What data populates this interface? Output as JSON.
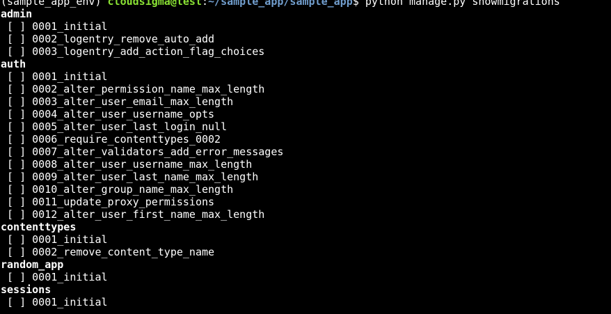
{
  "prompt": {
    "env": "(sample_app_env) ",
    "userhost": "cloudsigma@test",
    "colon": ":",
    "path": "~/sample_app/sample_app",
    "symbol": "$ ",
    "command": "python manage.py showmigrations"
  },
  "colors": {
    "userhost": "#8ae234",
    "path": "#729fcf",
    "background": "#000000",
    "text": "#ffffff"
  },
  "apps": [
    {
      "name": "admin",
      "migrations": [
        {
          "check": " [ ] ",
          "name": "0001_initial"
        },
        {
          "check": " [ ] ",
          "name": "0002_logentry_remove_auto_add"
        },
        {
          "check": " [ ] ",
          "name": "0003_logentry_add_action_flag_choices"
        }
      ]
    },
    {
      "name": "auth",
      "migrations": [
        {
          "check": " [ ] ",
          "name": "0001_initial"
        },
        {
          "check": " [ ] ",
          "name": "0002_alter_permission_name_max_length"
        },
        {
          "check": " [ ] ",
          "name": "0003_alter_user_email_max_length"
        },
        {
          "check": " [ ] ",
          "name": "0004_alter_user_username_opts"
        },
        {
          "check": " [ ] ",
          "name": "0005_alter_user_last_login_null"
        },
        {
          "check": " [ ] ",
          "name": "0006_require_contenttypes_0002"
        },
        {
          "check": " [ ] ",
          "name": "0007_alter_validators_add_error_messages"
        },
        {
          "check": " [ ] ",
          "name": "0008_alter_user_username_max_length"
        },
        {
          "check": " [ ] ",
          "name": "0009_alter_user_last_name_max_length"
        },
        {
          "check": " [ ] ",
          "name": "0010_alter_group_name_max_length"
        },
        {
          "check": " [ ] ",
          "name": "0011_update_proxy_permissions"
        },
        {
          "check": " [ ] ",
          "name": "0012_alter_user_first_name_max_length"
        }
      ]
    },
    {
      "name": "contenttypes",
      "migrations": [
        {
          "check": " [ ] ",
          "name": "0001_initial"
        },
        {
          "check": " [ ] ",
          "name": "0002_remove_content_type_name"
        }
      ]
    },
    {
      "name": "random_app",
      "migrations": [
        {
          "check": " [ ] ",
          "name": "0001_initial"
        }
      ]
    },
    {
      "name": "sessions",
      "migrations": [
        {
          "check": " [ ] ",
          "name": "0001_initial"
        }
      ]
    }
  ]
}
